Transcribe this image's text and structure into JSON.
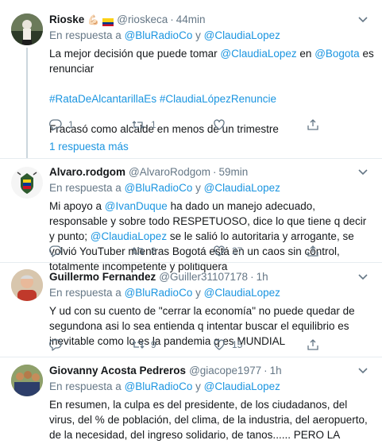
{
  "reply_prefix": "En respuesta a",
  "reply_and": "y",
  "tweets": [
    {
      "name": "Rioske",
      "emoji": "💪🏻",
      "handle": "@rioskeca",
      "time": "44min",
      "reply_a": "@BluRadioCo",
      "reply_b": "@ClaudiaLopez",
      "lines": [
        [
          "La mejor decisión que puede tomar ",
          "@ClaudiaLopez",
          " en ",
          "@Bogota",
          " es renunciar"
        ],
        [
          "#RataDeAlcantarillaEs",
          " ",
          "#ClaudiaLópezRenuncie"
        ],
        [
          "Fracasó como alcalde en menos de un trimestre"
        ]
      ],
      "replies": "1",
      "retweets": "1",
      "likes": "",
      "more_replies": "1 respuesta más"
    },
    {
      "name": "Alvaro.rodgom",
      "handle": "@AlvaroRodgom",
      "time": "59min",
      "reply_a": "@BluRadioCo",
      "reply_b": "@ClaudiaLopez",
      "text_parts": [
        "Mi apoyo a ",
        "@IvanDuque",
        " ha dado un manejo adecuado, responsable y sobre todo RESPETUOSO, dice lo que tiene q decir y punto; ",
        "@ClaudiaLopez",
        " se le salió lo autoritaria y arrogante, se volvió YouTuber mientras Bogotá está en un caos sin control, totalmente incompetente y politiquera"
      ],
      "replies": "",
      "retweets": "8",
      "likes": "27"
    },
    {
      "name": "Guillermo Fernandez",
      "handle": "@Guiller31107178",
      "time": "1h",
      "reply_a": "@BluRadioCo",
      "reply_b": "@ClaudiaLopez",
      "text": "Y ud con su cuento de \"cerrar la economía\" no puede quedar de segundona asi lo sea entienda q intentar buscar el equilibrio es inevitable como lo es la pandemia q es MUNDIAL",
      "replies": "",
      "retweets": "9",
      "likes": "15"
    },
    {
      "name": "Giovanny Acosta Pedreros",
      "handle": "@giacope1977",
      "time": "1h",
      "reply_a": "@BluRadioCo",
      "reply_b": "@ClaudiaLopez",
      "text": "En resumen,  la culpa es del presidente, de los ciudadanos, del virus, del % de población, del clima, de la industria, del aeropuerto, de la necesidad, del ingreso solidario, de tanos...... PERO LA ALCALDESA LO HA HECHO TOOOOOOOO PERFECTO!......",
      "emoji_end": "🤦🏻‍♂️"
    }
  ]
}
